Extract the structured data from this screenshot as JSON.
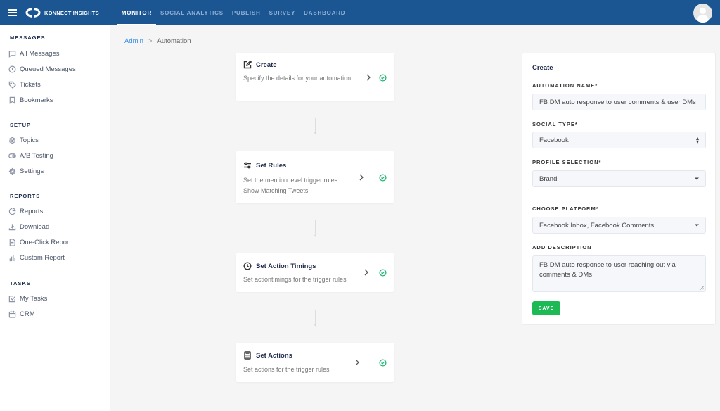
{
  "topbar": {
    "brand": "KONNECT INSIGHTS",
    "nav": [
      {
        "label": "MONITOR",
        "active": true
      },
      {
        "label": "SOCIAL ANALYTICS",
        "active": false
      },
      {
        "label": "PUBLISH",
        "active": false
      },
      {
        "label": "SURVEY",
        "active": false
      },
      {
        "label": "DASHBOARD",
        "active": false
      }
    ],
    "accent": "#1b5693"
  },
  "sidebar": {
    "sections": [
      {
        "title": "MESSAGES",
        "items": [
          {
            "label": "All Messages",
            "icon": "chat-icon"
          },
          {
            "label": "Queued Messages",
            "icon": "clock-icon"
          },
          {
            "label": "Tickets",
            "icon": "tag-icon"
          },
          {
            "label": "Bookmarks",
            "icon": "bookmark-icon"
          }
        ]
      },
      {
        "title": "SETUP",
        "items": [
          {
            "label": "Topics",
            "icon": "layers-icon"
          },
          {
            "label": "A/B Testing",
            "icon": "toggle-icon"
          },
          {
            "label": "Settings",
            "icon": "gear-icon"
          }
        ]
      },
      {
        "title": "REPORTS",
        "items": [
          {
            "label": "Reports",
            "icon": "pie-chart-icon"
          },
          {
            "label": "Download",
            "icon": "download-icon"
          },
          {
            "label": "One-Click Report",
            "icon": "document-icon"
          },
          {
            "label": "Custom Report",
            "icon": "bar-chart-icon"
          }
        ]
      },
      {
        "title": "TASKS",
        "items": [
          {
            "label": "My Tasks",
            "icon": "checkbox-icon"
          },
          {
            "label": "CRM",
            "icon": "calendar-icon"
          }
        ]
      }
    ]
  },
  "breadcrumb": {
    "parent": "Admin",
    "separator": ">",
    "current": "Automation"
  },
  "steps": [
    {
      "title": "Create",
      "icon": "edit-icon",
      "description": "Specify the details for your automation",
      "completed": true
    },
    {
      "title": "Set Rules",
      "icon": "sliders-icon",
      "description": "Set the mention level trigger rules",
      "description2": "Show Matching Tweets",
      "completed": true
    },
    {
      "title": "Set Action Timings",
      "icon": "clock-icon",
      "description": "Set actiontimings for the trigger rules",
      "completed": true
    },
    {
      "title": "Set Actions",
      "icon": "calculator-icon",
      "description": "Set actions for the trigger rules",
      "completed": true
    }
  ],
  "form": {
    "title": "Create",
    "automation_name_label": "AUTOMATION NAME*",
    "automation_name_value": "FB DM auto response to user comments & user DMs",
    "social_type_label": "SOCIAL TYPE*",
    "social_type_value": "Facebook",
    "profile_selection_label": "PROFILE SELECTION*",
    "profile_selection_value": "Brand",
    "platform_label": "CHOOSE PLATFORM*",
    "platform_value": "Facebook Inbox, Facebook Comments",
    "description_label": "ADD DESCRIPTION",
    "description_value": "FB DM auto response to user reaching out via comments & DMs",
    "save_label": "SAVE",
    "save_color": "#1db954"
  }
}
